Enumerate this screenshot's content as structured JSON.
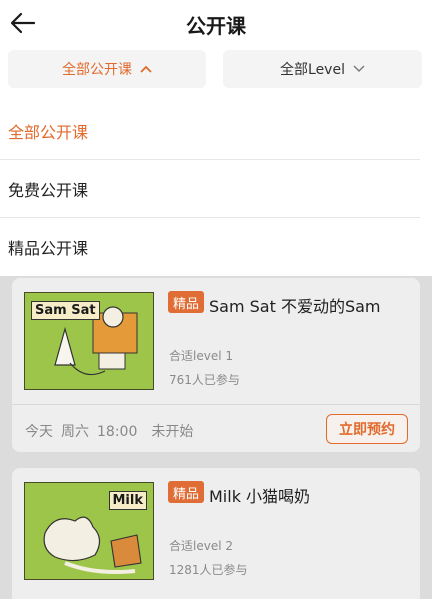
{
  "header": {
    "title": "公开课",
    "back_icon": "arrow-left-icon"
  },
  "filters": {
    "all_label": "全部公开课",
    "all_icon": "chevron-up-icon",
    "level_label": "全部Level",
    "level_icon": "chevron-down-icon"
  },
  "dropdown": {
    "items": [
      {
        "label": "全部公开课",
        "selected": true
      },
      {
        "label": "免费公开课",
        "selected": false
      },
      {
        "label": "精品公开课",
        "selected": false
      }
    ]
  },
  "courses": [
    {
      "thumb_text": "Sam Sat",
      "tag": "精品",
      "title": "Sam Sat 不爱动的Sam",
      "level": "合适level  1",
      "participants": "761人已参与",
      "schedule_day": "今天",
      "schedule_weekday": "周六",
      "schedule_time": "18:00",
      "status": "未开始",
      "action_label": "立即预约"
    },
    {
      "thumb_text": "Milk",
      "tag": "精品",
      "title": "Milk 小猫喝奶",
      "level": "合适level  2",
      "participants": "1281人已参与"
    }
  ],
  "colors": {
    "accent": "#e26a2c",
    "tag_bg": "#e06d35",
    "overlay": "#dcdcdc"
  }
}
